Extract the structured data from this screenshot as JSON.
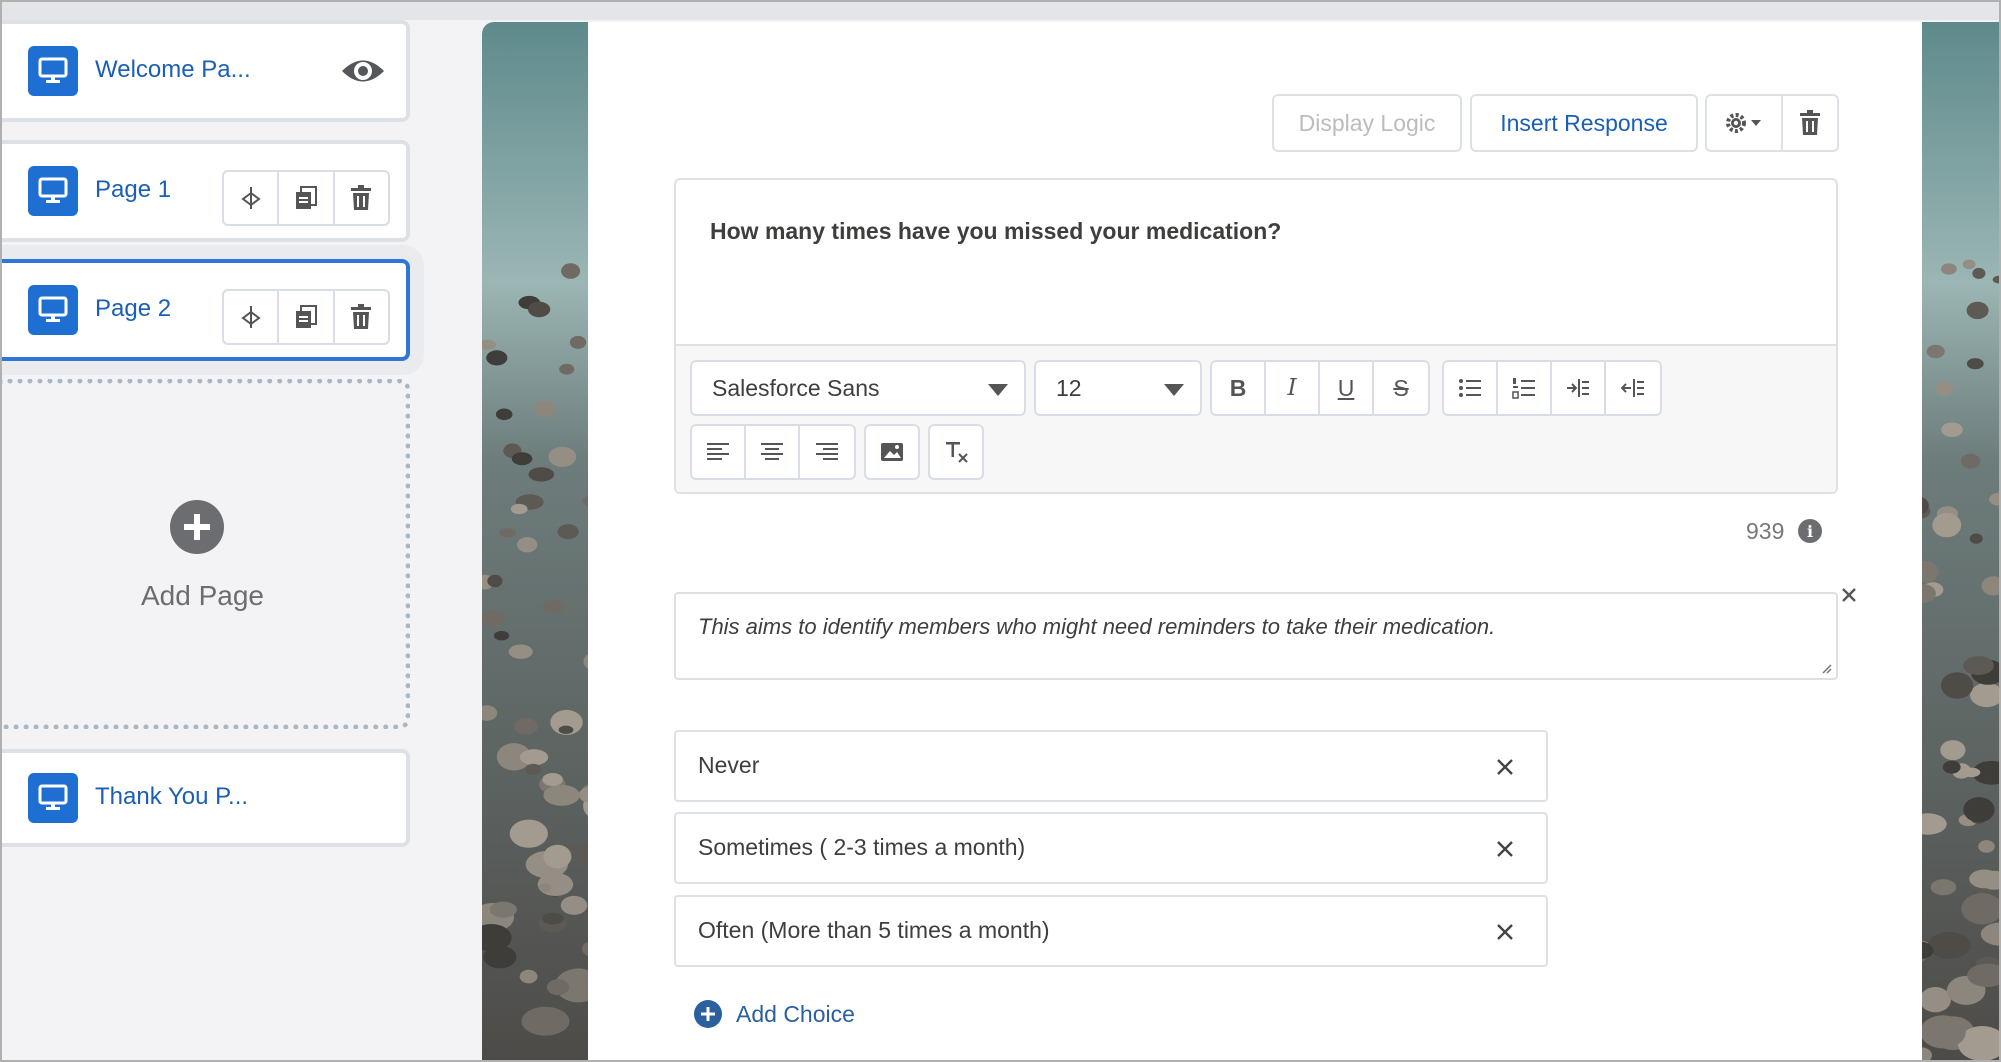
{
  "pages": [
    {
      "label": "Welcome Pa..."
    },
    {
      "label": "Page 1"
    },
    {
      "label": "Page 2"
    },
    {
      "label": "Thank You P..."
    }
  ],
  "add_page_label": "Add Page",
  "toolbar": {
    "display_logic_label": "Display Logic",
    "insert_response_label": "Insert Response"
  },
  "question": {
    "text": "How many times have you missed your medication?",
    "font_family": "Salesforce Sans",
    "font_size": "12",
    "char_count": "939",
    "description": "This aims to identify members who might need reminders to take their medication."
  },
  "choices": [
    {
      "label": "Never"
    },
    {
      "label": "Sometimes ( 2-3 times a month)"
    },
    {
      "label": "Often (More than 5 times a month)"
    }
  ],
  "add_choice_label": "Add Choice",
  "colors": {
    "accent": "#1f6fd2",
    "link": "#1b5fb5",
    "selected_border": "#2f77d6"
  }
}
